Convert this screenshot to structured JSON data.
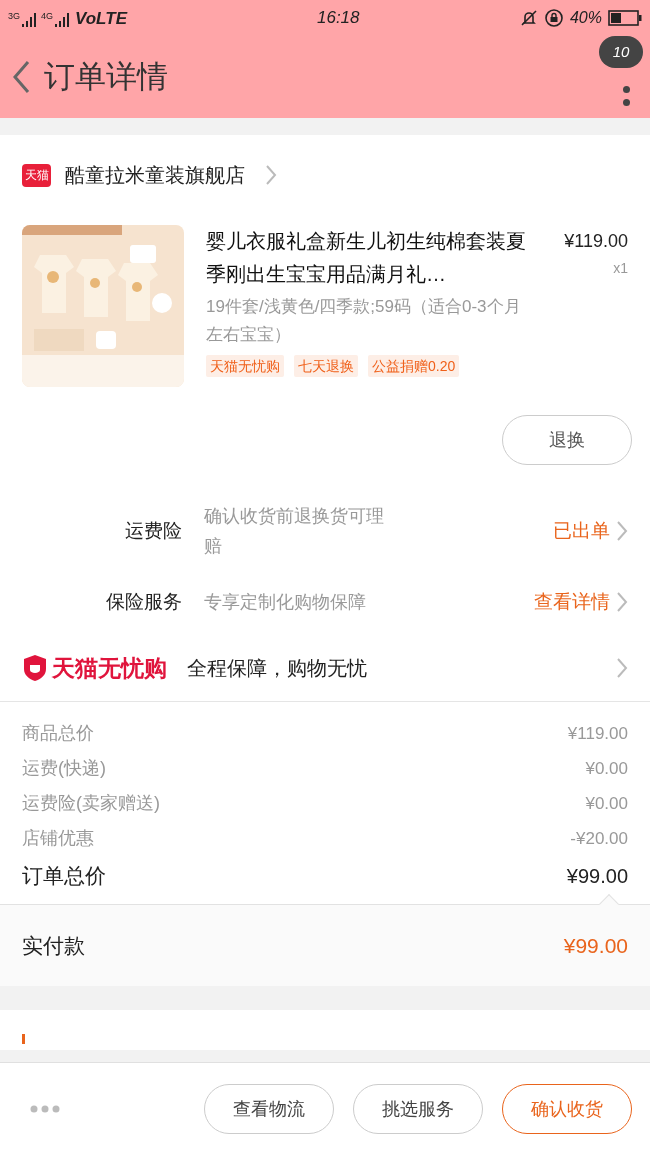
{
  "status_bar": {
    "signal_1": "3G",
    "signal_2": "4G",
    "carrier": "VoLTE",
    "time": "16:18",
    "battery": "40%"
  },
  "header": {
    "title": "订单详情",
    "badge": "10"
  },
  "store": {
    "badge": "天猫",
    "name": "酷童拉米童装旗舰店"
  },
  "product": {
    "title": "婴儿衣服礼盒新生儿初生纯棉套装夏季刚出生宝宝用品满月礼…",
    "price": "¥119.00",
    "quantity": "x1",
    "spec": "19件套/浅黄色/四季款;59码（适合0-3个月左右宝宝）",
    "tags": [
      "天猫无忧购",
      "七天退换",
      "公益捐赠0.20"
    ],
    "action": "退换"
  },
  "services": [
    {
      "label": "运费险",
      "desc": "确认收货前退换货可理赔",
      "status": "已出单"
    },
    {
      "label": "保险服务",
      "desc": "专享定制化购物保障",
      "status": "查看详情"
    }
  ],
  "guarantee": {
    "logo": "天猫无忧购",
    "slogan": "全程保障，购物无忧"
  },
  "summary": {
    "lines": [
      {
        "label": "商品总价",
        "amount": "¥119.00"
      },
      {
        "label": "运费(快递)",
        "amount": "¥0.00"
      },
      {
        "label": "运费险(卖家赠送)",
        "amount": "¥0.00"
      },
      {
        "label": "店铺优惠",
        "amount": "-¥20.00"
      }
    ],
    "total": {
      "label": "订单总价",
      "amount": "¥99.00"
    }
  },
  "payment": {
    "label": "实付款",
    "amount": "¥99.00"
  },
  "footer": {
    "buttons": [
      {
        "label": "查看物流",
        "kind": "default"
      },
      {
        "label": "挑选服务",
        "kind": "default"
      },
      {
        "label": "确认收货",
        "kind": "primary"
      }
    ]
  }
}
